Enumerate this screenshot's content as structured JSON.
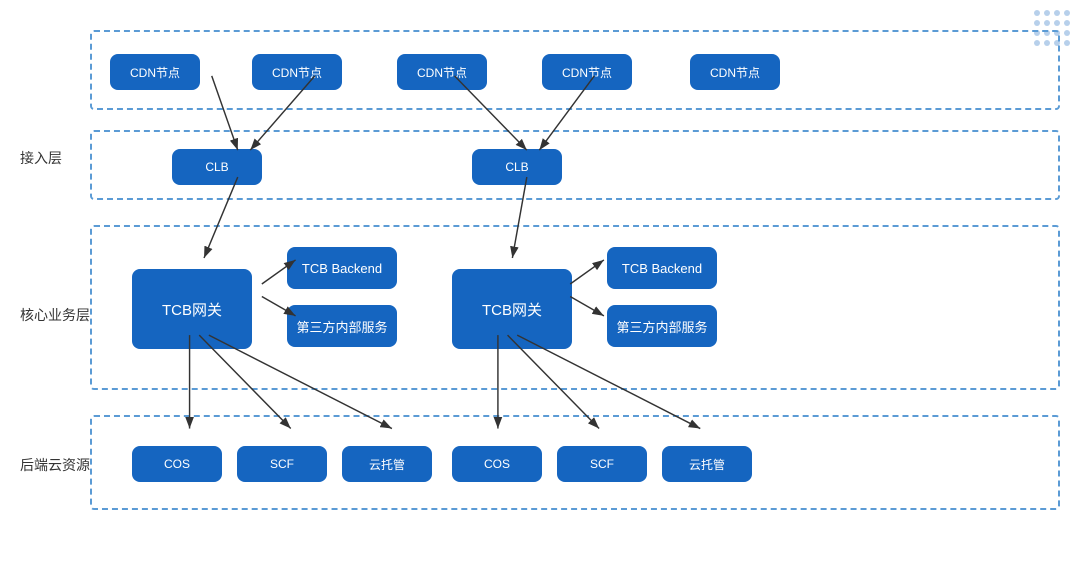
{
  "labels": {
    "access_layer": "接入层",
    "core_layer": "核心业务层",
    "backend_layer": "后端云资源"
  },
  "nodes": {
    "cdn": [
      "CDN节点",
      "CDN节点",
      "CDN节点",
      "CDN节点",
      "CDN节点"
    ],
    "clb_left": "CLB",
    "clb_right": "CLB",
    "tcb_left": "TCB网关",
    "tcb_right": "TCB网关",
    "tcb_backend_left": "TCB Backend",
    "tcb_backend_right": "TCB Backend",
    "third_party_left": "第三方内部服务",
    "third_party_right": "第三方内部服务",
    "cos_left": "COS",
    "scf_left": "SCF",
    "cloud_mgr_left": "云托管",
    "cos_right": "COS",
    "scf_right": "SCF",
    "cloud_mgr_right": "云托管"
  }
}
